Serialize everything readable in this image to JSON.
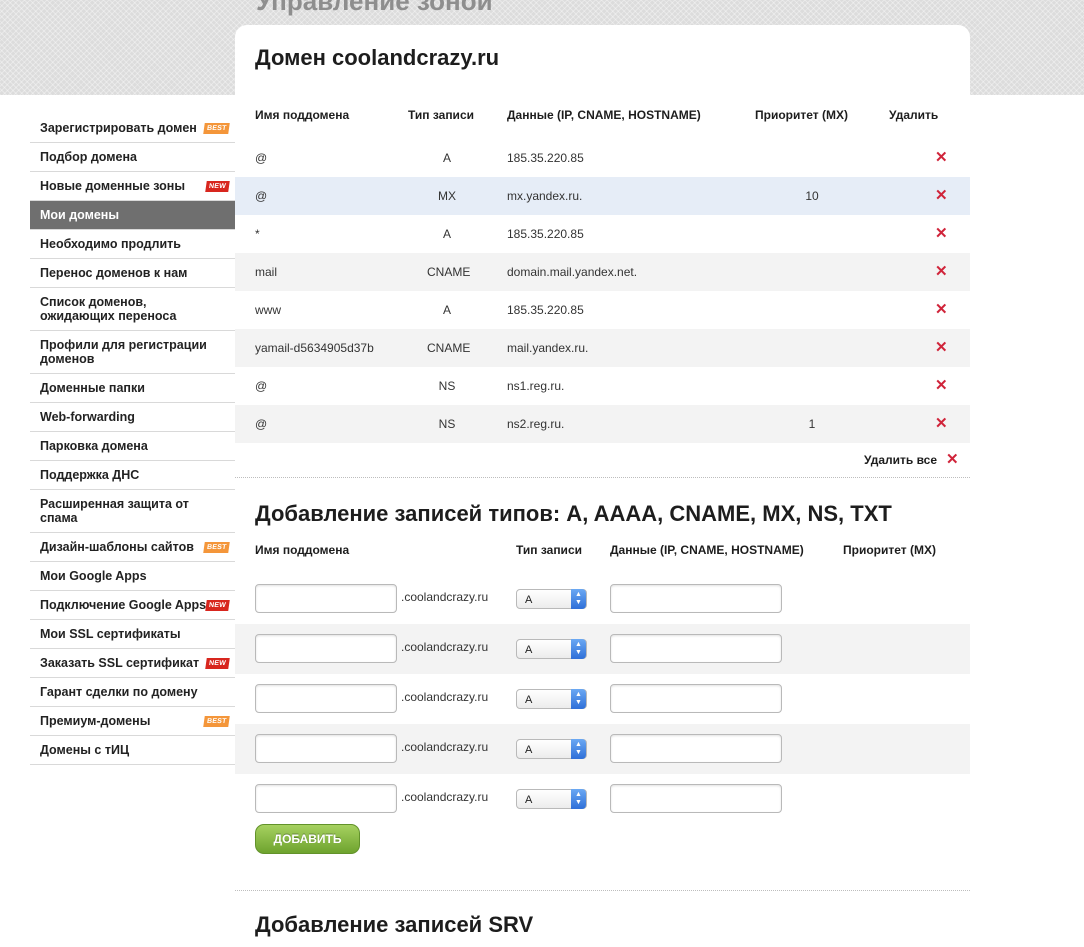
{
  "page": {
    "heading": "Управление зоной"
  },
  "sidebar": {
    "items": [
      {
        "label": "Зарегистрировать домен",
        "badge": "BEST"
      },
      {
        "label": "Подбор домена"
      },
      {
        "label": "Новые доменные зоны",
        "badge": "NEW"
      },
      {
        "label": "Мои домены",
        "active": true
      },
      {
        "label": "Необходимо продлить"
      },
      {
        "label": "Перенос доменов к нам"
      },
      {
        "label": "Список доменов, ожидающих переноса"
      },
      {
        "label": "Профили для регистрации доменов"
      },
      {
        "label": "Доменные папки"
      },
      {
        "label": "Web-forwarding"
      },
      {
        "label": "Парковка домена"
      },
      {
        "label": "Поддержка ДНС"
      },
      {
        "label": "Расширенная защита от спама"
      },
      {
        "label": "Дизайн-шаблоны сайтов",
        "badge": "BEST"
      },
      {
        "label": "Мои Google Apps"
      },
      {
        "label": "Подключение Google Apps",
        "badge": "NEW"
      },
      {
        "label": "Мои SSL сертификаты"
      },
      {
        "label": "Заказать SSL сертификат",
        "badge": "NEW"
      },
      {
        "label": "Гарант сделки по домену"
      },
      {
        "label": "Премиум-домены",
        "badge": "BEST"
      },
      {
        "label": "Домены с тИЦ"
      }
    ]
  },
  "zone": {
    "title": "Домен coolandcrazy.ru",
    "columns": {
      "name": "Имя поддомена",
      "type": "Тип записи",
      "data": "Данные (IP, CNAME, HOSTNAME)",
      "priority": "Приоритет (MX)",
      "delete": "Удалить"
    },
    "records": [
      {
        "name": "@",
        "type": "A",
        "data": "185.35.220.85",
        "priority": ""
      },
      {
        "name": "@",
        "type": "MX",
        "data": "mx.yandex.ru.",
        "priority": "10"
      },
      {
        "name": "*",
        "type": "A",
        "data": "185.35.220.85",
        "priority": ""
      },
      {
        "name": "mail",
        "type": "CNAME",
        "data": "domain.mail.yandex.net.",
        "priority": ""
      },
      {
        "name": "www",
        "type": "A",
        "data": "185.35.220.85",
        "priority": ""
      },
      {
        "name": "yamail-d5634905d37b",
        "type": "CNAME",
        "data": "mail.yandex.ru.",
        "priority": ""
      },
      {
        "name": "@",
        "type": "NS",
        "data": "ns1.reg.ru.",
        "priority": ""
      },
      {
        "name": "@",
        "type": "NS",
        "data": "ns2.reg.ru.",
        "priority": "1"
      }
    ],
    "delete_symbol": "✕",
    "delete_all_label": "Удалить все"
  },
  "add_records": {
    "title": "Добавление записей типов: A, AAAA, CNAME, MX, NS, TXT",
    "columns": {
      "name": "Имя поддомена",
      "type": "Тип записи",
      "data": "Данные (IP, CNAME, HOSTNAME)",
      "priority": "Приоритет (MX)"
    },
    "domain_suffix": ".coolandcrazy.ru",
    "default_type": "A",
    "rows": 5,
    "submit_label": "ДОБАВИТЬ"
  },
  "srv": {
    "title": "Добавление записей SRV"
  },
  "colors": {
    "delete": "#d0243a",
    "active_item": "#6f6f6f",
    "button": "#7fb23a",
    "highlight_row": "#e6edf7"
  }
}
